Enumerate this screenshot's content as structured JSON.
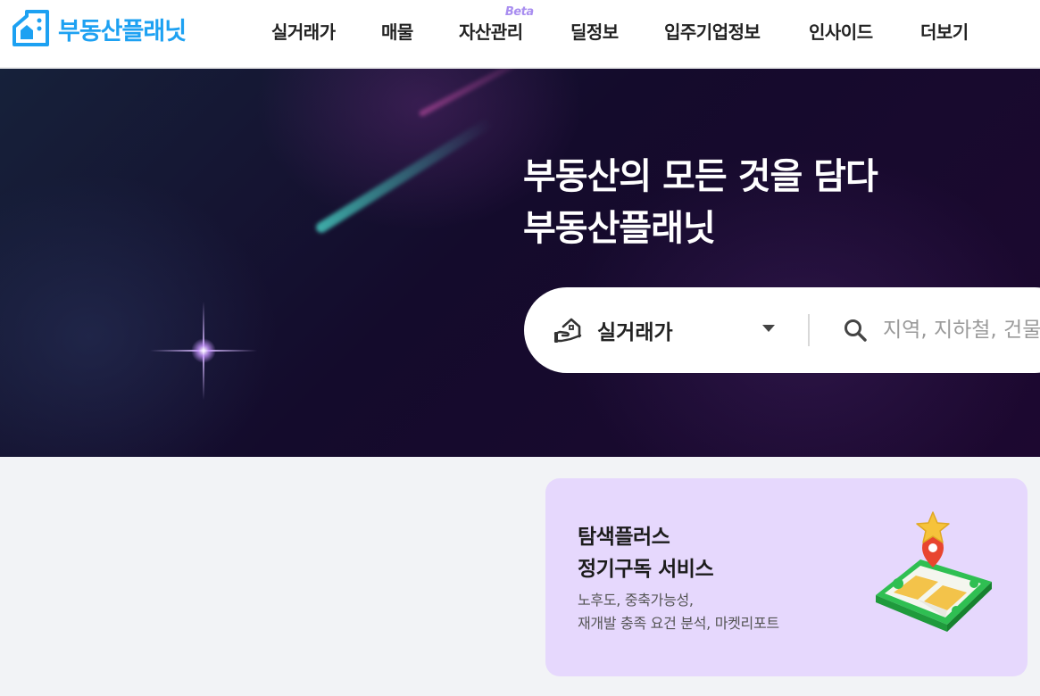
{
  "header": {
    "logo_text": "부동산플래닛",
    "nav": [
      {
        "label": "실거래가"
      },
      {
        "label": "매물"
      },
      {
        "label": "자산관리",
        "badge": "Beta"
      },
      {
        "label": "딜정보"
      },
      {
        "label": "입주기업정보"
      },
      {
        "label": "인사이드"
      },
      {
        "label": "더보기"
      }
    ]
  },
  "hero": {
    "title_line1": "부동산의 모든 것을 담다",
    "title_line2": "부동산플래닛"
  },
  "search": {
    "type_icon": "house-hand-icon",
    "type_selected": "실거래가",
    "placeholder": "지역, 지하철, 건물명"
  },
  "promo": {
    "title_line1": "탐색플러스",
    "title_line2": "정기구독 서비스",
    "desc_line1": "노후도, 중축가능성,",
    "desc_line2": "재개발 충족 요건 분석, 마켓리포트"
  },
  "colors": {
    "brand": "#1da1f2",
    "beta": "#a98ef0",
    "promo_bg": "#e6d8fd",
    "page_bg": "#f2f3f6"
  }
}
